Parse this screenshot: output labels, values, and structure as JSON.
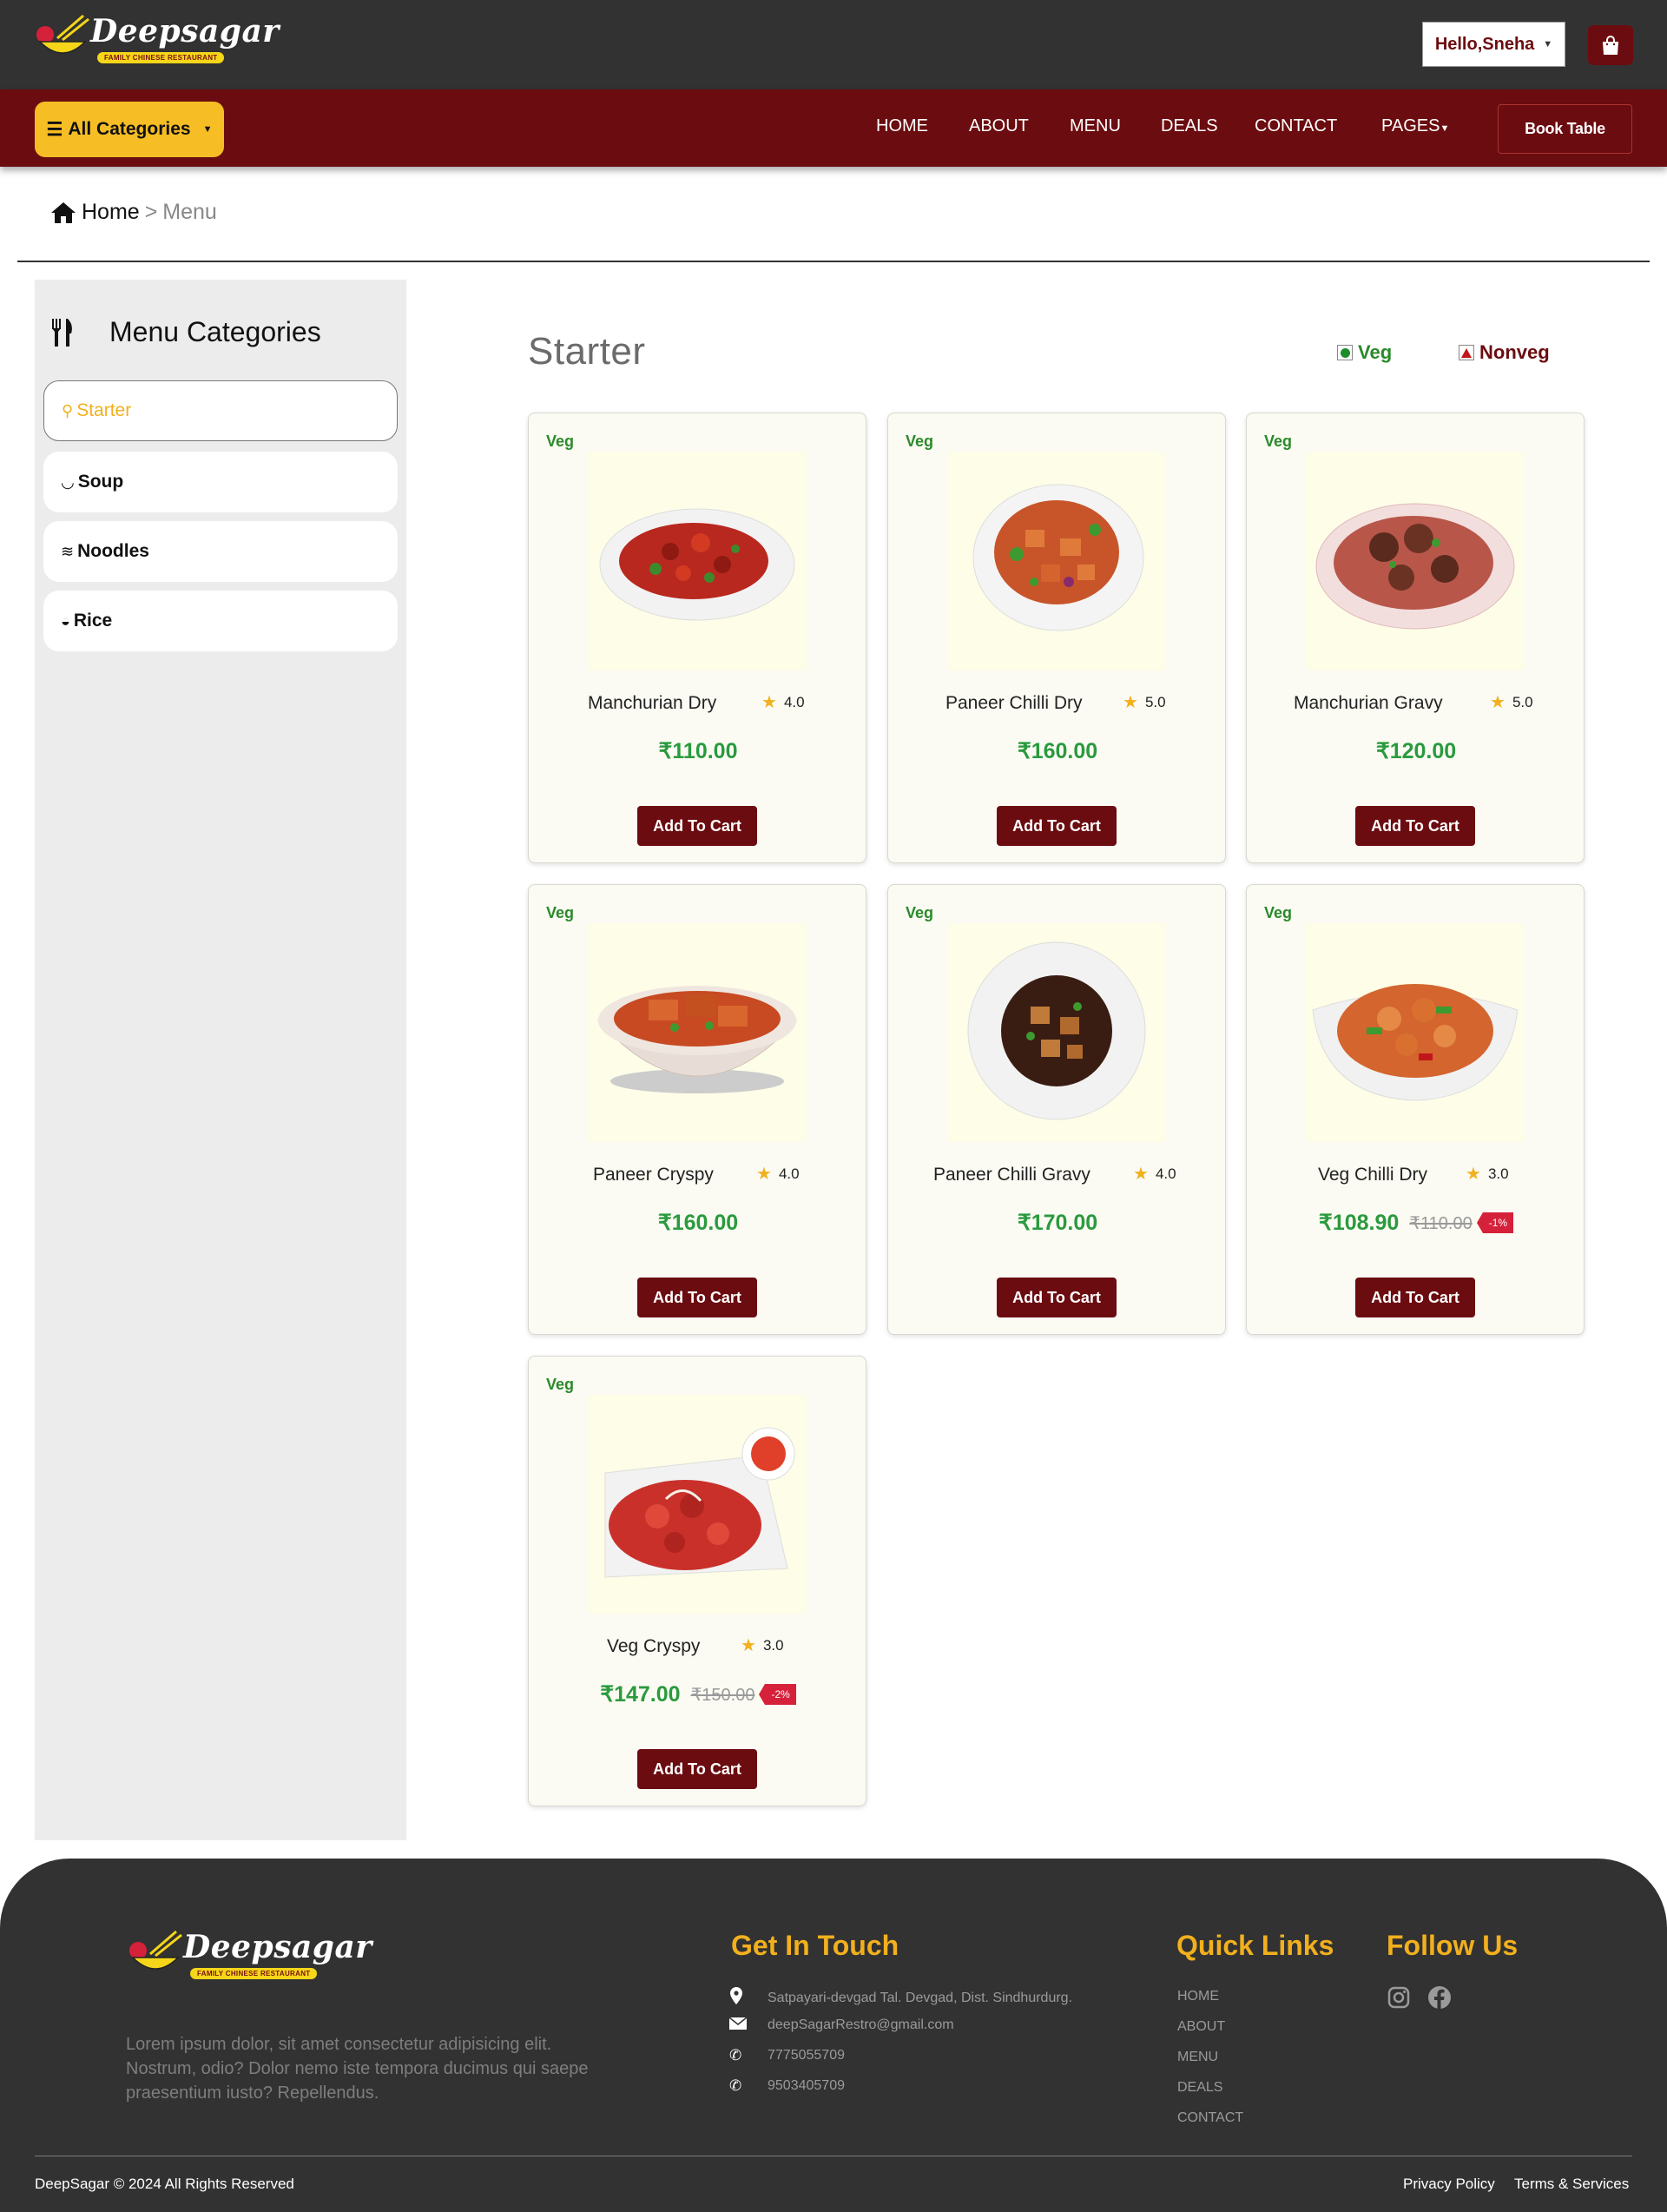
{
  "header": {
    "brand": "Deepsagar",
    "tagline": "FAMILY CHINESE RESTAURANT",
    "user_greeting": "Hello,Sneha",
    "cart_icon": "shopping-bag-icon"
  },
  "nav": {
    "all_categories": "All Categories",
    "links": [
      "HOME",
      "ABOUT",
      "MENU",
      "DEALS",
      "CONTACT",
      "PAGES"
    ],
    "book_table": "Book Table"
  },
  "breadcrumb": {
    "home": "Home",
    "separator": ">",
    "current": "Menu"
  },
  "sidebar": {
    "title": "Menu Categories",
    "items": [
      {
        "label": "Starter",
        "icon": "search-icon",
        "active": true
      },
      {
        "label": "Soup",
        "icon": "soup-bowl-icon",
        "active": false
      },
      {
        "label": "Noodles",
        "icon": "noodles-icon",
        "active": false
      },
      {
        "label": "Rice",
        "icon": "rice-bowl-icon",
        "active": false
      }
    ]
  },
  "content": {
    "section_title": "Starter",
    "legend_veg": "Veg",
    "legend_nonveg": "Nonveg",
    "add_to_cart": "Add To Cart",
    "items": [
      {
        "tag": "Veg",
        "name": "Manchurian Dry",
        "rating": "4.0",
        "price": "₹110.00",
        "old_price": "",
        "discount": ""
      },
      {
        "tag": "Veg",
        "name": "Paneer Chilli Dry",
        "rating": "5.0",
        "price": "₹160.00",
        "old_price": "",
        "discount": ""
      },
      {
        "tag": "Veg",
        "name": "Manchurian Gravy",
        "rating": "5.0",
        "price": "₹120.00",
        "old_price": "",
        "discount": ""
      },
      {
        "tag": "Veg",
        "name": "Paneer Cryspy",
        "rating": "4.0",
        "price": "₹160.00",
        "old_price": "",
        "discount": ""
      },
      {
        "tag": "Veg",
        "name": "Paneer Chilli Gravy",
        "rating": "4.0",
        "price": "₹170.00",
        "old_price": "",
        "discount": ""
      },
      {
        "tag": "Veg",
        "name": "Veg Chilli Dry",
        "rating": "3.0",
        "price": "₹108.90",
        "old_price": "₹110.00",
        "discount": "-1%"
      },
      {
        "tag": "Veg",
        "name": "Veg Cryspy",
        "rating": "3.0",
        "price": "₹147.00",
        "old_price": "₹150.00",
        "discount": "-2%"
      }
    ]
  },
  "footer": {
    "brand": "Deepsagar",
    "tagline": "FAMILY CHINESE RESTAURANT",
    "description": "Lorem ipsum dolor, sit amet consectetur adipisicing elit. Nostrum, odio? Dolor nemo iste tempora ducimus qui saepe praesentium iusto? Repellendus.",
    "get_in_touch": "Get In Touch",
    "address": "Satpayari-devgad Tal. Devgad, Dist. Sindhurdurg.",
    "email": "deepSagarRestro@gmail.com",
    "phone1": "7775055709",
    "phone2": "9503405709",
    "quick_links_title": "Quick Links",
    "quick_links": [
      "HOME",
      "ABOUT",
      "MENU",
      "DEALS",
      "CONTACT"
    ],
    "follow_us": "Follow Us",
    "social": [
      "instagram-icon",
      "facebook-icon"
    ],
    "copyright": "DeepSagar © 2024 All Rights Reserved",
    "privacy": "Privacy Policy",
    "terms": "Terms & Services"
  },
  "colors": {
    "maroon": "#6b0c10",
    "gold": "#f7bd25",
    "dark": "#323232",
    "veg_green": "#2a9a3e"
  }
}
